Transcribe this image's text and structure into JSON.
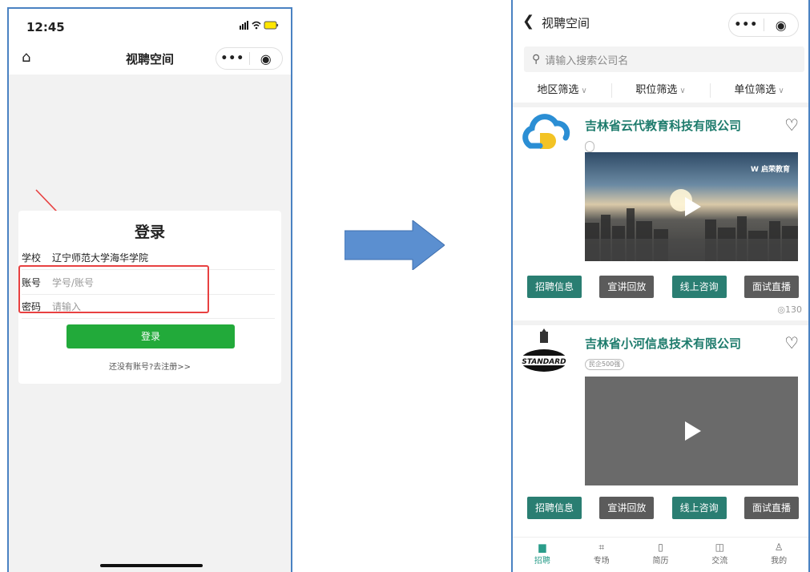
{
  "left_phone": {
    "status_time": "12:45",
    "nav_title": "视聘空间",
    "capsule_more": "•••",
    "capsule_close": "◉",
    "login": {
      "title": "登录",
      "school_label": "学校",
      "school_value": "辽宁师范大学海华学院",
      "account_label": "账号",
      "account_placeholder": "学号/账号",
      "password_label": "密码",
      "password_placeholder": "请输入",
      "submit_label": "登录",
      "register_link": "还没有账号?去注册>>"
    }
  },
  "right_phone": {
    "nav_title": "视聘空间",
    "capsule_more": "•••",
    "capsule_close": "◉",
    "search_placeholder": "请输入搜索公司名",
    "filters": [
      "地区筛选",
      "职位筛选",
      "单位筛选"
    ],
    "companies": [
      {
        "name": "吉林省云代教育科技有限公司",
        "tag": "",
        "video_brand": "W 启荣教育",
        "actions": [
          "招聘信息",
          "宣讲回放",
          "线上咨询",
          "面试直播"
        ],
        "views": "130"
      },
      {
        "name": "吉林省小河信息技术有限公司",
        "tag": "民企500强",
        "actions": [
          "招聘信息",
          "宣讲回放",
          "线上咨询",
          "面试直播"
        ]
      }
    ],
    "tabs": [
      {
        "label": "招聘",
        "icon": "briefcase-icon"
      },
      {
        "label": "专场",
        "icon": "venue-icon"
      },
      {
        "label": "简历",
        "icon": "resume-icon"
      },
      {
        "label": "交流",
        "icon": "chat-icon"
      },
      {
        "label": "我的",
        "icon": "user-icon"
      }
    ],
    "accent_color": "#2a7e72"
  }
}
